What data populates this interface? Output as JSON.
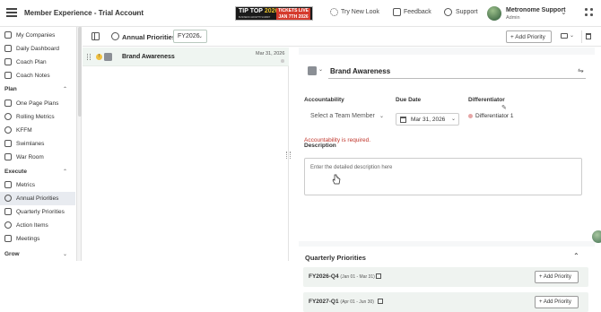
{
  "header": {
    "account_title": "Member Experience - Trial Account",
    "promo": {
      "title_part1": "TIP TOP",
      "title_part2": "2026",
      "subtitle": "BUSINESS GROWTH SUMMIT",
      "badge_line1": "TICKETS LIVE",
      "badge_line2": "JAN 7TH 2026"
    },
    "try_new_look": "Try New Look",
    "feedback": "Feedback",
    "support": "Support",
    "user_name": "Metronome Support",
    "user_role": "Admin"
  },
  "sidebar": {
    "top_items": [
      {
        "label": "My Companies",
        "icon": "companies-icon"
      },
      {
        "label": "Daily Dashboard",
        "icon": "dashboard-icon"
      },
      {
        "label": "Coach Plan",
        "icon": "coach-plan-icon"
      },
      {
        "label": "Coach Notes",
        "icon": "notes-icon"
      }
    ],
    "sections": [
      {
        "label": "Plan",
        "items": [
          {
            "label": "One Page Plans",
            "icon": "page-icon"
          },
          {
            "label": "Rolling Metrics",
            "icon": "rolling-icon"
          },
          {
            "label": "KFFM",
            "icon": "kffm-icon"
          },
          {
            "label": "Swimlanes",
            "icon": "swimlanes-icon"
          },
          {
            "label": "War Room",
            "icon": "war-room-icon"
          }
        ]
      },
      {
        "label": "Execute",
        "items": [
          {
            "label": "Metrics",
            "icon": "metrics-icon"
          },
          {
            "label": "Annual Priorities",
            "icon": "target-icon",
            "active": true
          },
          {
            "label": "Quarterly Priorities",
            "icon": "quarterly-icon"
          },
          {
            "label": "Action Items",
            "icon": "action-items-icon"
          },
          {
            "label": "Meetings",
            "icon": "meetings-icon"
          }
        ]
      },
      {
        "label": "Grow",
        "items": []
      }
    ]
  },
  "toolbar": {
    "title": "Annual Priorities",
    "fiscal_year": "FY2026",
    "add_priority": "+ Add Priority"
  },
  "priority_list": [
    {
      "badge": "!",
      "title": "Brand Awareness",
      "date": "Mar 31, 2026"
    }
  ],
  "detail": {
    "title": "Brand Awareness",
    "accountability_label": "Accountability",
    "team_member_placeholder": "Select a Team Member",
    "accountability_error": "Accountability is required.",
    "due_date_label": "Due Date",
    "due_date": "Mar 31, 2026",
    "differentiator_label": "Differentiator",
    "differentiator_value": "Differentiator 1",
    "description_label": "Description",
    "description_placeholder": "Enter the detailed description here"
  },
  "quarterly": {
    "title": "Quarterly Priorities",
    "rows": [
      {
        "quarter": "FY2026-Q4",
        "range": "(Jan 01 - Mar 31)",
        "add_label": "+ Add Priority"
      },
      {
        "quarter": "FY2027-Q1",
        "range": "(Apr 01 - Jun 30)",
        "add_label": "+ Add Priority"
      }
    ]
  },
  "colors": {
    "accent_green": "#2e7d4f",
    "error_red": "#c0352b",
    "active_row": "#eff5f1",
    "promo_red": "#d53a2c"
  }
}
